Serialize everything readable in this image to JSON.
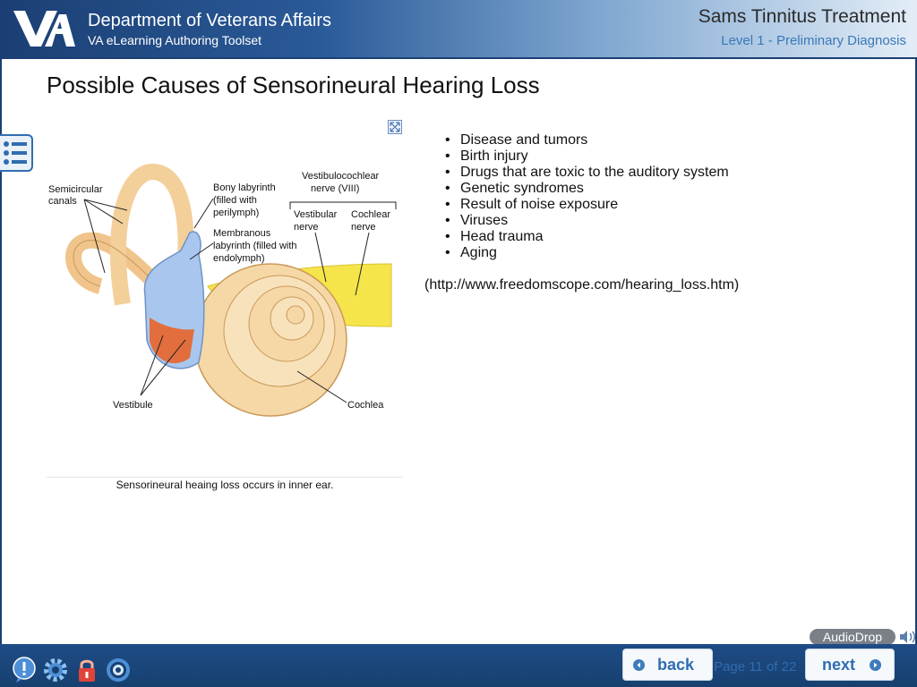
{
  "header": {
    "department": "Department of Veterans Affairs",
    "toolset": "VA eLearning Authoring Toolset",
    "course_title": "Sams Tinnitus Treatment",
    "level": "Level 1 - Preliminary Diagnosis"
  },
  "page": {
    "title": "Possible Causes of Sensorineural Hearing Loss"
  },
  "figure": {
    "caption": "Sensorineural heaing loss occurs in inner ear.",
    "labels": {
      "semicircular": [
        "Semicircular",
        "canals"
      ],
      "bony": [
        "Bony labyrinth",
        "(filled with",
        "perilymph)"
      ],
      "membranous": [
        "Membranous",
        "labyrinth (filled with",
        "endolymph)"
      ],
      "vestibulocochlear": [
        "Vestibulocochlear",
        "nerve (VIII)"
      ],
      "vestibular_nerve": [
        "Vestibular",
        "nerve"
      ],
      "cochlear_nerve": [
        "Cochlear",
        "nerve"
      ],
      "vestibule": "Vestibule",
      "cochlea": "Cochlea"
    }
  },
  "causes": [
    "Disease and tumors",
    "Birth injury",
    "Drugs that are toxic to the auditory system",
    "Genetic syndromes",
    "Result of noise exposure",
    "Viruses",
    "Head trauma",
    "Aging"
  ],
  "source": "(http://www.freedomscope.com/hearing_loss.htm)",
  "audio": {
    "label": "AudioDrop"
  },
  "footer": {
    "back_label": "back",
    "next_label": "next",
    "page_counter": "Page 11 of 22"
  },
  "colors": {
    "header_dark": "#1b3f74",
    "accent_blue": "#2f6db0",
    "cochlea_fill": "#f6d8a6",
    "labyrinth_blue": "#a9c7ee",
    "endolymph_orange": "#e8642a",
    "nerve_yellow": "#f6e54a"
  }
}
